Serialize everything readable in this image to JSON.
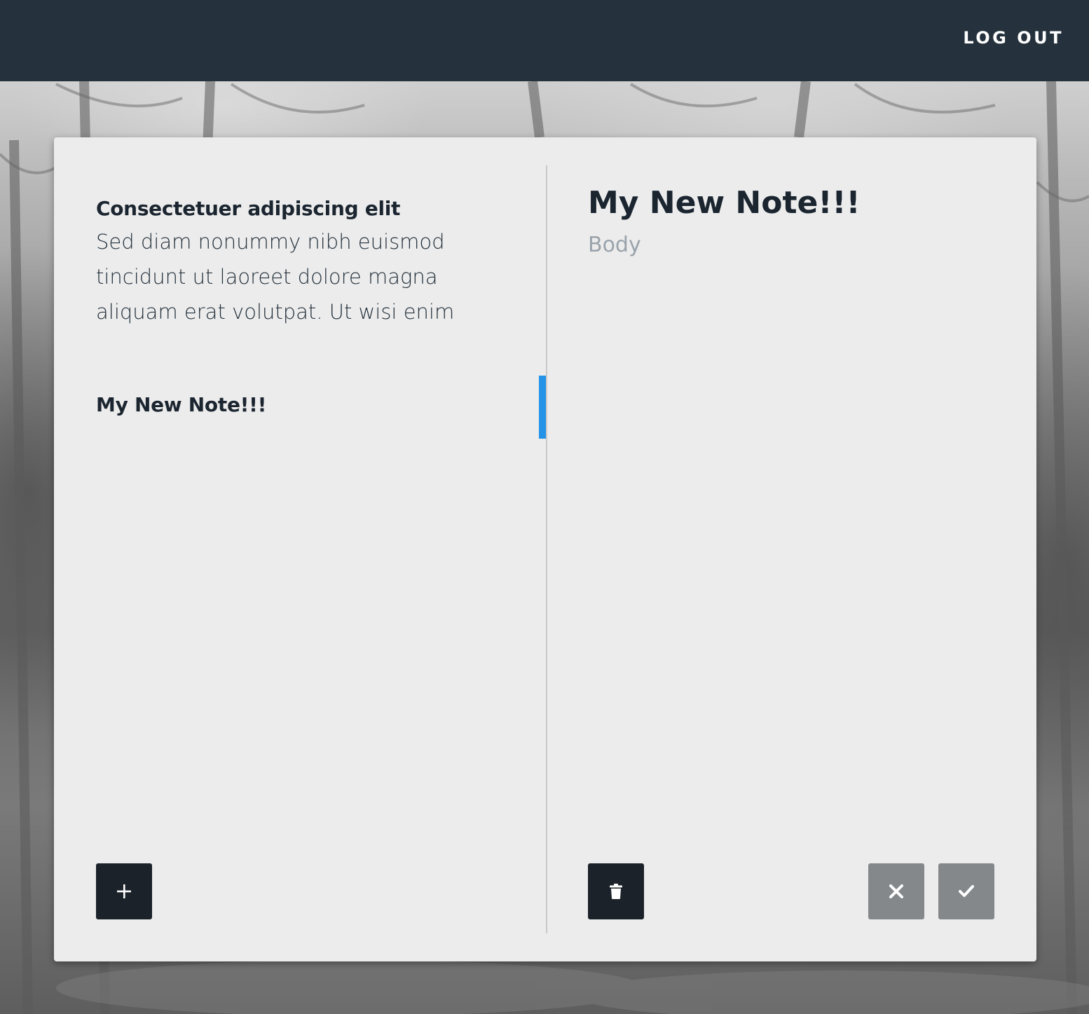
{
  "header": {
    "logout_label": "LOG OUT",
    "background_color": "#25323d"
  },
  "notes": [
    {
      "title": "Consectetuer adipiscing elit",
      "body": "Sed diam nonummy nibh euismod tincidunt ut laoreet dolore magna aliquam erat volutpat. Ut wisi enim",
      "active": false
    },
    {
      "title": "My New Note!!!",
      "body": "",
      "active": true
    }
  ],
  "editor": {
    "title_value": "My New Note!!!",
    "body_value": "",
    "body_placeholder": "Body"
  },
  "buttons": {
    "add_icon": "plus-icon",
    "delete_icon": "trash-icon",
    "cancel_icon": "close-icon",
    "confirm_icon": "check-icon"
  },
  "colors": {
    "accent": "#2492e6",
    "card_background": "#ececec",
    "dark_button": "#1b2229",
    "grey_button": "#84888b"
  }
}
